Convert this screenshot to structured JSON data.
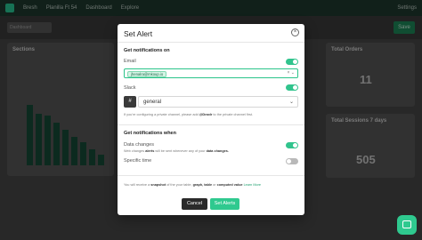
{
  "background": {
    "topbar_items": [
      "Bresh",
      "Planilla Ft 54",
      "Dashboard",
      "Explore"
    ],
    "topbar_right": "Settings",
    "subbar_input": "Dashboard",
    "subbar_button": "Save",
    "cards": {
      "sections": "Sections",
      "total_orders": "Total Orders",
      "total_orders_value": "11",
      "total_sessions": "Total Sessions 7 days",
      "total_sessions_value": "505"
    }
  },
  "modal": {
    "title": "Set Alert",
    "get_notifications_on": "Get notifications on",
    "email_label": "Email",
    "email_chip": "jhenalra@mkoup.io",
    "email_icons": "× ⌄",
    "slack_label": "Slack",
    "slack_value": "general",
    "slack_hint_pre": "If you're configuring a private channel, please add ",
    "slack_hint_bold": "@Draxlr",
    "slack_hint_post": " to the private channel first.",
    "get_notifications_when": "Get notifications when",
    "data_changes_label": "Data changes",
    "data_changes_hint_pre": "Web changes ",
    "data_changes_hint_bold1": "alerts",
    "data_changes_hint_mid": " will be sent whenever any of your ",
    "data_changes_hint_bold2": "data changes.",
    "specific_time_label": "Specific time",
    "footnote_pre": "You will receive a ",
    "footnote_b1": "snapshot",
    "footnote_mid1": " of the your table, ",
    "footnote_b2": "graph, table",
    "footnote_mid2": " or ",
    "footnote_b3": "computed value",
    "footnote_link": "Learn More",
    "cancel": "Cancel",
    "set_alerts": "Set Alerts",
    "toggles": {
      "email": true,
      "slack": true,
      "data_changes": true,
      "specific_time": false
    }
  },
  "colors": {
    "accent": "#2fc98f",
    "dark_button": "#2a2a2a"
  },
  "icons": {
    "close": "close-icon",
    "slack": "slack-icon",
    "chat": "chat-icon",
    "chevron": "chevron-down-icon"
  }
}
